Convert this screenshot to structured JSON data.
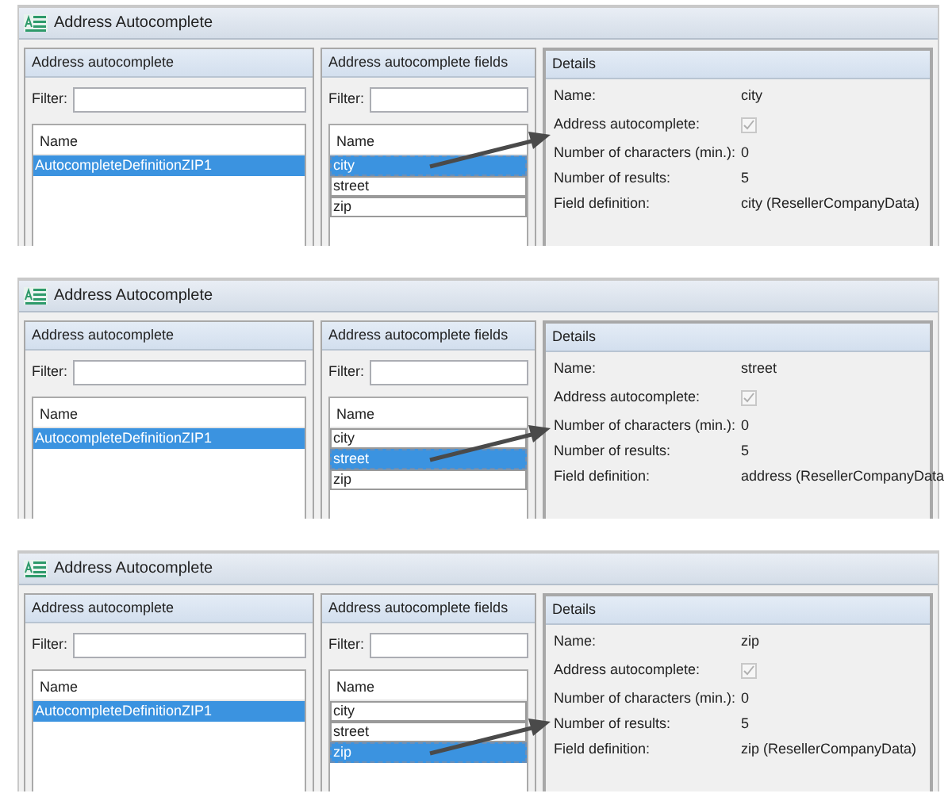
{
  "panels": [
    {
      "window_title": "Address Autocomplete",
      "definitions": {
        "title": "Address autocomplete",
        "filter_label": "Filter:",
        "column": "Name",
        "items": [
          {
            "label": "AutocompleteDefinitionZIP1",
            "selected": true
          }
        ]
      },
      "fields": {
        "title": "Address autocomplete fields",
        "filter_label": "Filter:",
        "column": "Name",
        "items": [
          {
            "label": "city",
            "selected": true
          },
          {
            "label": "street",
            "selected": false
          },
          {
            "label": "zip",
            "selected": false
          }
        ]
      },
      "details": {
        "title": "Details",
        "rows": [
          {
            "kind": "text",
            "label": "Name:",
            "value": "city"
          },
          {
            "kind": "checkbox",
            "label": "Address autocomplete:",
            "checked": true
          },
          {
            "kind": "text",
            "label": "Number of characters (min.):",
            "value": "0"
          },
          {
            "kind": "text",
            "label": "Number of results:",
            "value": "5"
          },
          {
            "kind": "text",
            "label": "Field definition:",
            "value": "city (ResellerCompanyData)"
          }
        ]
      }
    },
    {
      "window_title": "Address Autocomplete",
      "definitions": {
        "title": "Address autocomplete",
        "filter_label": "Filter:",
        "column": "Name",
        "items": [
          {
            "label": "AutocompleteDefinitionZIP1",
            "selected": true
          }
        ]
      },
      "fields": {
        "title": "Address autocomplete fields",
        "filter_label": "Filter:",
        "column": "Name",
        "items": [
          {
            "label": "city",
            "selected": false
          },
          {
            "label": "street",
            "selected": true
          },
          {
            "label": "zip",
            "selected": false
          }
        ]
      },
      "details": {
        "title": "Details",
        "rows": [
          {
            "kind": "text",
            "label": "Name:",
            "value": "street"
          },
          {
            "kind": "checkbox",
            "label": "Address autocomplete:",
            "checked": true
          },
          {
            "kind": "text",
            "label": "Number of characters (min.):",
            "value": "0"
          },
          {
            "kind": "text",
            "label": "Number of results:",
            "value": "5"
          },
          {
            "kind": "text",
            "label": "Field definition:",
            "value": "address (ResellerCompanyData"
          }
        ]
      }
    },
    {
      "window_title": "Address Autocomplete",
      "definitions": {
        "title": "Address autocomplete",
        "filter_label": "Filter:",
        "column": "Name",
        "items": [
          {
            "label": "AutocompleteDefinitionZIP1",
            "selected": true
          }
        ]
      },
      "fields": {
        "title": "Address autocomplete fields",
        "filter_label": "Filter:",
        "column": "Name",
        "items": [
          {
            "label": "city",
            "selected": false
          },
          {
            "label": "street",
            "selected": false
          },
          {
            "label": "zip",
            "selected": true
          }
        ]
      },
      "details": {
        "title": "Details",
        "rows": [
          {
            "kind": "text",
            "label": "Name:",
            "value": "zip"
          },
          {
            "kind": "checkbox",
            "label": "Address autocomplete:",
            "checked": true
          },
          {
            "kind": "text",
            "label": "Number of characters (min.):",
            "value": "0"
          },
          {
            "kind": "text",
            "label": "Number of results:",
            "value": "5"
          },
          {
            "kind": "text",
            "label": "Field definition:",
            "value": "zip (ResellerCompanyData)"
          }
        ]
      }
    }
  ]
}
